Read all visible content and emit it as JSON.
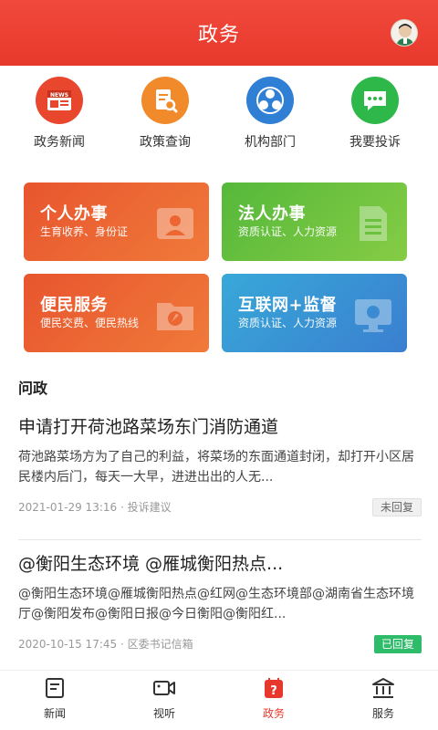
{
  "header": {
    "title": "政务"
  },
  "quick_links": [
    {
      "label": "政务新闻",
      "icon": "news-icon",
      "color": "#e8472e",
      "icon_text": "NEWS"
    },
    {
      "label": "政策查询",
      "icon": "policy-search-icon",
      "color": "#f08a2a"
    },
    {
      "label": "机构部门",
      "icon": "organization-icon",
      "color": "#2f7fd4"
    },
    {
      "label": "我要投诉",
      "icon": "complaint-chat-icon",
      "color": "#2fb84a"
    }
  ],
  "services": [
    {
      "title": "个人办事",
      "subtitle": "生育收养、身份证",
      "color_from": "#e8552e",
      "color_to": "#f07a3a"
    },
    {
      "title": "法人办事",
      "subtitle": "资质认证、人力资源",
      "color_from": "#55b83a",
      "color_to": "#86cc45"
    },
    {
      "title": "便民服务",
      "subtitle": "便民交费、便民热线",
      "color_from": "#e8552e",
      "color_to": "#f07a3a"
    },
    {
      "title": "互联网+监督",
      "subtitle": "资质认证、人力资源",
      "color_from": "#38a8d8",
      "color_to": "#3a7fd0"
    }
  ],
  "section": {
    "title": "问政"
  },
  "posts": [
    {
      "title": "申请打开荷池路菜场东门消防通道",
      "body": "荷池路菜场方为了自己的利益，将菜场的东面通道封闭，却打开小区居民楼内后门，每天一大早，进进出出的人无...",
      "meta": "2021-01-29 13:16 · 投诉建议",
      "status": "未回复"
    },
    {
      "title": "@衡阳生态环境 @雁城衡阳热点...",
      "body": "@衡阳生态环境@雁城衡阳热点@红网@生态环境部@湖南省生态环境厅@衡阳发布@衡阳日报@今日衡阳@衡阳红...",
      "meta": "2020-10-15 17:45 · 区委书记信箱",
      "status": "已回复"
    }
  ],
  "tabbar": {
    "active": "政务",
    "items": [
      {
        "label": "新闻",
        "icon": "news-doc-icon"
      },
      {
        "label": "视听",
        "icon": "video-camera-icon"
      },
      {
        "label": "政务",
        "icon": "government-affairs-icon"
      },
      {
        "label": "服务",
        "icon": "service-building-icon"
      }
    ]
  },
  "colors": {
    "brand_red": "#e8382c",
    "replied_green": "#2ebb6a"
  }
}
